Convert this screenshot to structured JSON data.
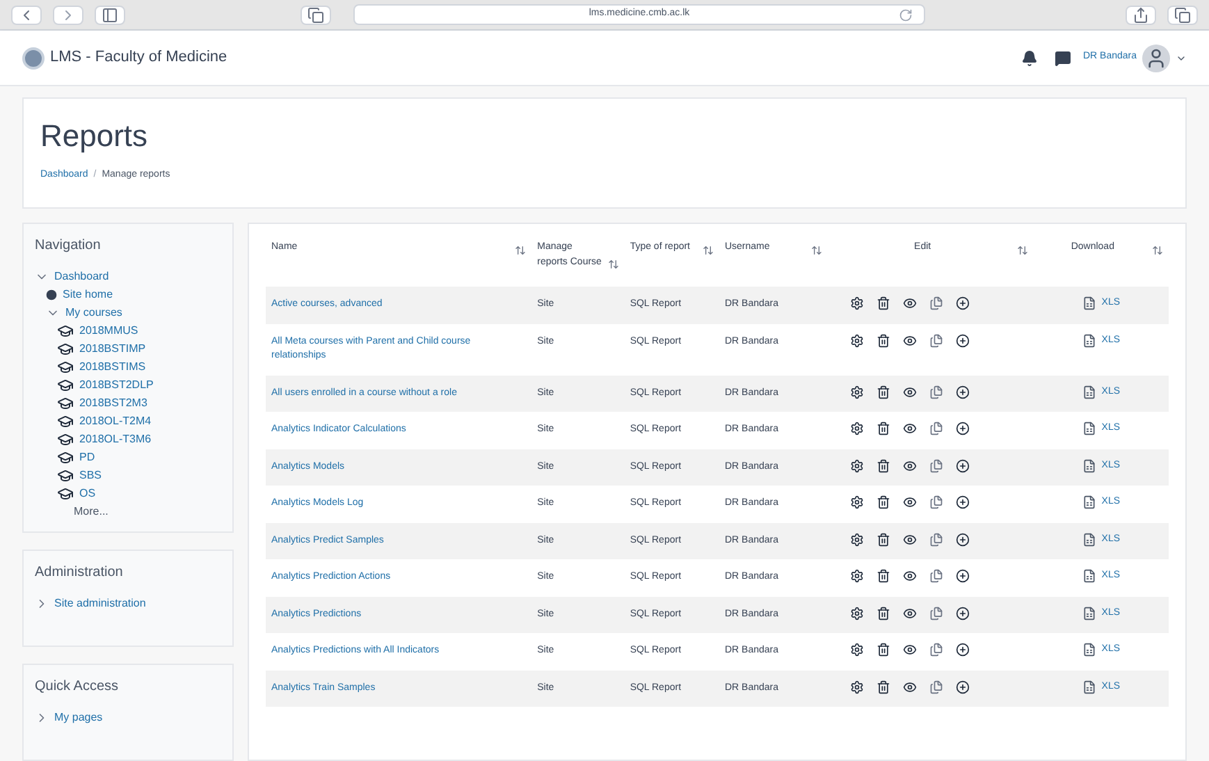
{
  "browser": {
    "url": "lms.medicine.cmb.ac.lk"
  },
  "header": {
    "site_name": "LMS - Faculty of Medicine",
    "user_name": "DR Bandara"
  },
  "page": {
    "title": "Reports",
    "breadcrumbs": [
      "Dashboard",
      "Manage reports"
    ],
    "breadcrumb_separator": "/"
  },
  "navigation": {
    "title": "Navigation",
    "items": [
      {
        "label": "Dashboard",
        "kind": "folder",
        "expanded": true,
        "children": [
          {
            "label": "Site home",
            "kind": "page"
          },
          {
            "label": "My courses",
            "kind": "folder",
            "expanded": true,
            "children": [
              {
                "label": "2018MMUS",
                "kind": "course"
              },
              {
                "label": "2018BSTIMP",
                "kind": "course"
              },
              {
                "label": "2018BSTIMS",
                "kind": "course"
              },
              {
                "label": "2018BST2DLP",
                "kind": "course"
              },
              {
                "label": "2018BST2M3",
                "kind": "course"
              },
              {
                "label": "2018OL-T2M4",
                "kind": "course"
              },
              {
                "label": "2018OL-T3M6",
                "kind": "course"
              },
              {
                "label": "PD",
                "kind": "course"
              },
              {
                "label": "SBS",
                "kind": "course"
              },
              {
                "label": "OS",
                "kind": "course"
              },
              {
                "label": "More...",
                "kind": "link"
              }
            ]
          }
        ]
      }
    ]
  },
  "administration": {
    "title": "Administration",
    "items": [
      {
        "label": "Site administration",
        "kind": "folder",
        "expanded": false
      }
    ]
  },
  "quick_access": {
    "title": "Quick Access",
    "items": [
      {
        "label": "My pages",
        "kind": "folder",
        "expanded": false
      }
    ]
  },
  "table": {
    "columns": [
      "Name",
      "Manage reports Course",
      "Type of report",
      "Username",
      "Edit",
      "Download"
    ],
    "rows": [
      {
        "name": "Active courses, advanced",
        "course": "Site",
        "type": "SQL Report",
        "username": "DR Bandara",
        "download": "XLS"
      },
      {
        "name": "All Meta courses with Parent and Child course relationships",
        "course": "Site",
        "type": "SQL Report",
        "username": "DR Bandara",
        "download": "XLS"
      },
      {
        "name": "All users enrolled in a course without a role",
        "course": "Site",
        "type": "SQL Report",
        "username": "DR Bandara",
        "download": "XLS"
      },
      {
        "name": "Analytics Indicator Calculations",
        "course": "Site",
        "type": "SQL Report",
        "username": "DR Bandara",
        "download": "XLS"
      },
      {
        "name": "Analytics Models",
        "course": "Site",
        "type": "SQL Report",
        "username": "DR Bandara",
        "download": "XLS"
      },
      {
        "name": "Analytics Models Log",
        "course": "Site",
        "type": "SQL Report",
        "username": "DR Bandara",
        "download": "XLS"
      },
      {
        "name": "Analytics Predict Samples",
        "course": "Site",
        "type": "SQL Report",
        "username": "DR Bandara",
        "download": "XLS"
      },
      {
        "name": "Analytics Prediction Actions",
        "course": "Site",
        "type": "SQL Report",
        "username": "DR Bandara",
        "download": "XLS"
      },
      {
        "name": "Analytics Predictions",
        "course": "Site",
        "type": "SQL Report",
        "username": "DR Bandara",
        "download": "XLS"
      },
      {
        "name": "Analytics Predictions with All Indicators",
        "course": "Site",
        "type": "SQL Report",
        "username": "DR Bandara",
        "download": "XLS"
      },
      {
        "name": "Analytics Train Samples",
        "course": "Site",
        "type": "SQL Report",
        "username": "DR Bandara",
        "download": "XLS"
      }
    ]
  }
}
